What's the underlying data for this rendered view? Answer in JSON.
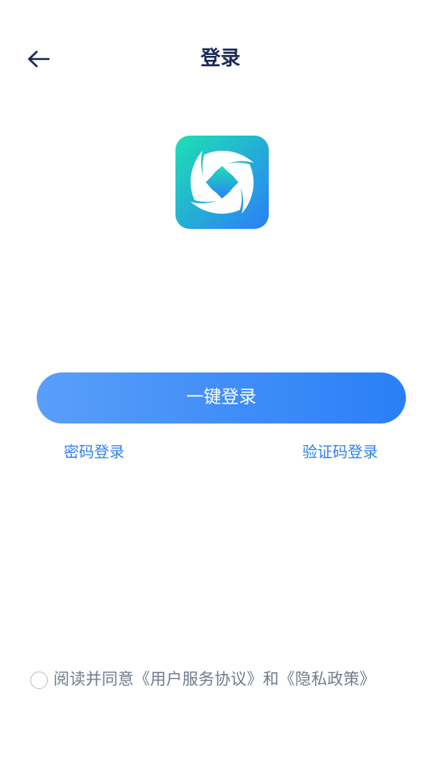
{
  "header": {
    "title": "登录",
    "back_icon": "arrow-left-icon"
  },
  "logo": {
    "icon": "app-logo-icon",
    "gradient_start": "#1ee0b4",
    "gradient_end": "#2a7ff7"
  },
  "actions": {
    "one_click_login": "一键登录",
    "password_login": "密码登录",
    "code_login": "验证码登录"
  },
  "agreement": {
    "text": "阅读并同意《用户服务协议》和《隐私政策》",
    "checked": false
  },
  "colors": {
    "title": "#1b2b59",
    "accent": "#2a7ff7",
    "muted_text": "#727b8c"
  }
}
